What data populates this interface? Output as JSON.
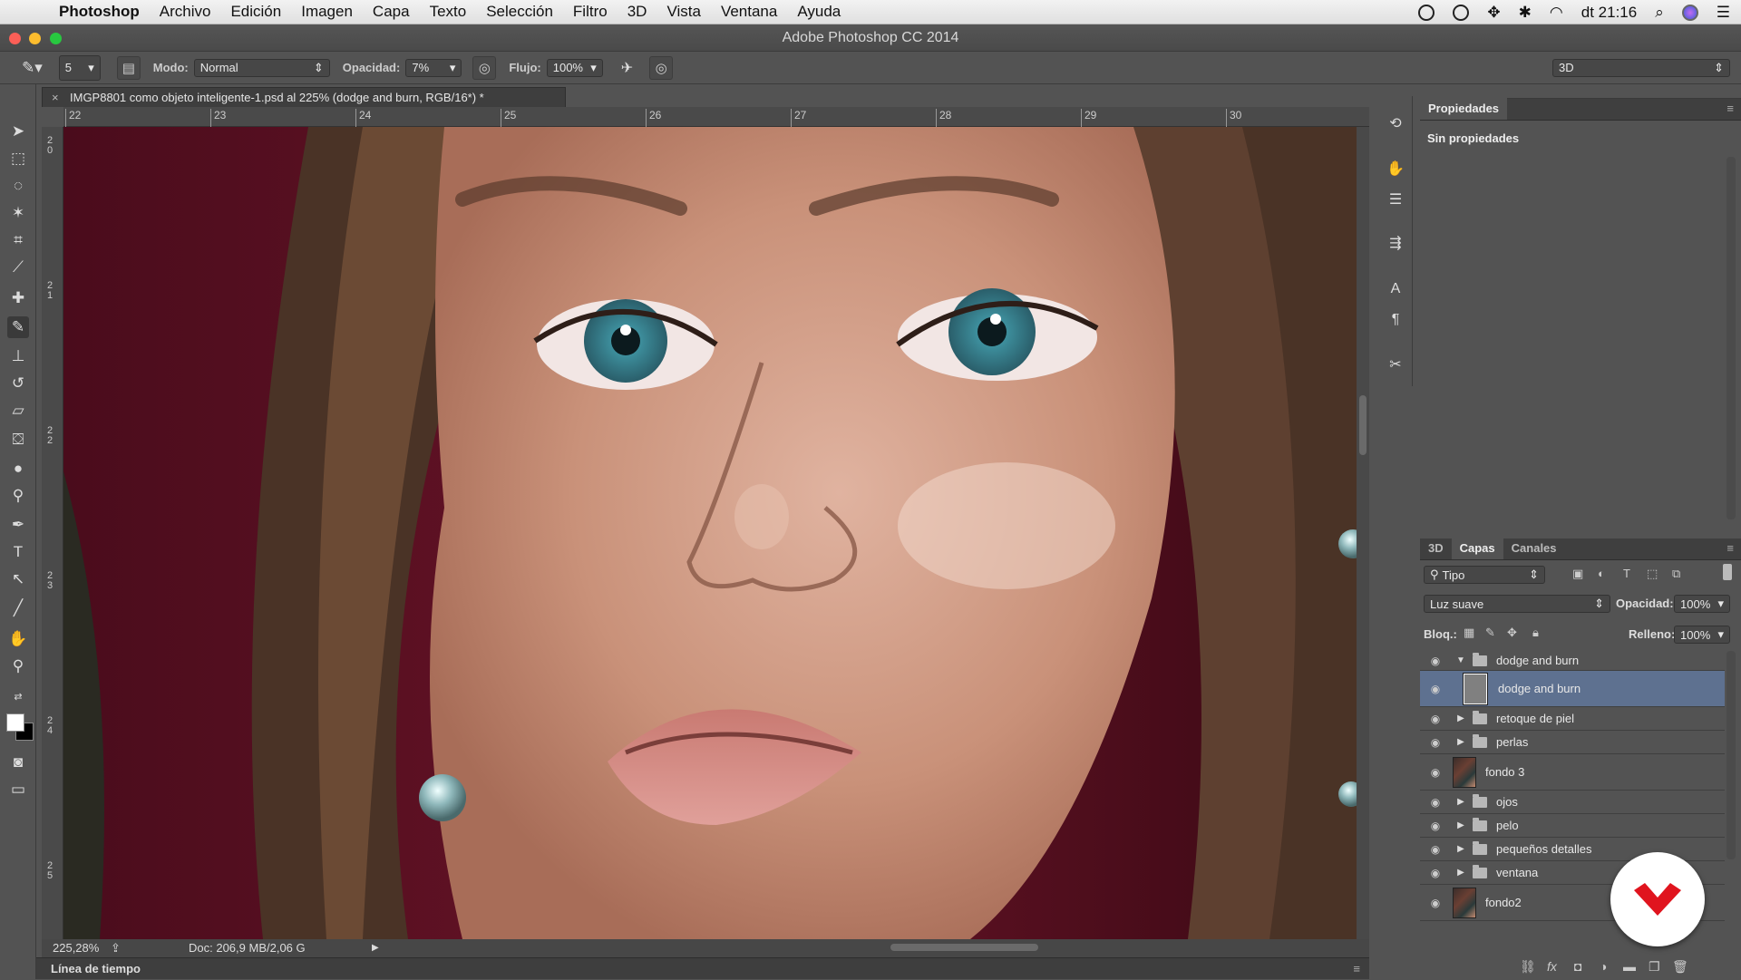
{
  "menubar": {
    "app": "Photoshop",
    "items": [
      "Archivo",
      "Edición",
      "Imagen",
      "Capa",
      "Texto",
      "Selección",
      "Filtro",
      "3D",
      "Vista",
      "Ventana",
      "Ayuda"
    ],
    "clock": "dt 21:16"
  },
  "window": {
    "title": "Adobe Photoshop CC 2014"
  },
  "options": {
    "brush_size": "5",
    "mode_label": "Modo:",
    "mode_value": "Normal",
    "opacity_label": "Opacidad:",
    "opacity_value": "7%",
    "flow_label": "Flujo:",
    "flow_value": "100%",
    "workspace": "3D"
  },
  "document": {
    "tab_title": "IMGP8801 como objeto inteligente-1.psd al 225% (dodge and burn, RGB/16*) *",
    "ruler_top": [
      "22",
      "23",
      "24",
      "25",
      "26",
      "27",
      "28",
      "29",
      "30"
    ],
    "ruler_left": [
      [
        "2",
        "0"
      ],
      [
        "2",
        "1"
      ],
      [
        "2",
        "2"
      ],
      [
        "2",
        "3"
      ],
      [
        "2",
        "4"
      ],
      [
        "2",
        "5"
      ]
    ],
    "zoom": "225,28%",
    "doc_info": "Doc: 206,9 MB/2,06 G"
  },
  "timeline": {
    "label": "Línea de tiempo"
  },
  "properties": {
    "tab": "Propiedades",
    "content": "Sin propiedades"
  },
  "layers": {
    "tabs": [
      "3D",
      "Capas",
      "Canales"
    ],
    "filter": "Tipo",
    "blend_mode": "Luz suave",
    "opacity_label": "Opacidad:",
    "opacity_value": "100%",
    "lock_label": "Bloq.:",
    "fill_label": "Relleno:",
    "fill_value": "100%",
    "items": [
      {
        "name": "dodge and burn",
        "kind": "group-open"
      },
      {
        "name": "dodge and burn",
        "kind": "layer-selected"
      },
      {
        "name": "retoque de piel",
        "kind": "group"
      },
      {
        "name": "perlas",
        "kind": "group"
      },
      {
        "name": "fondo 3",
        "kind": "image"
      },
      {
        "name": "ojos",
        "kind": "group"
      },
      {
        "name": "pelo",
        "kind": "group"
      },
      {
        "name": "pequeños detalles",
        "kind": "group"
      },
      {
        "name": "ventana",
        "kind": "group"
      },
      {
        "name": "fondo2",
        "kind": "image"
      }
    ]
  },
  "colors": {
    "selection": "#5e7190",
    "logo_red": "#e0141e",
    "panel_bg": "#535353"
  }
}
